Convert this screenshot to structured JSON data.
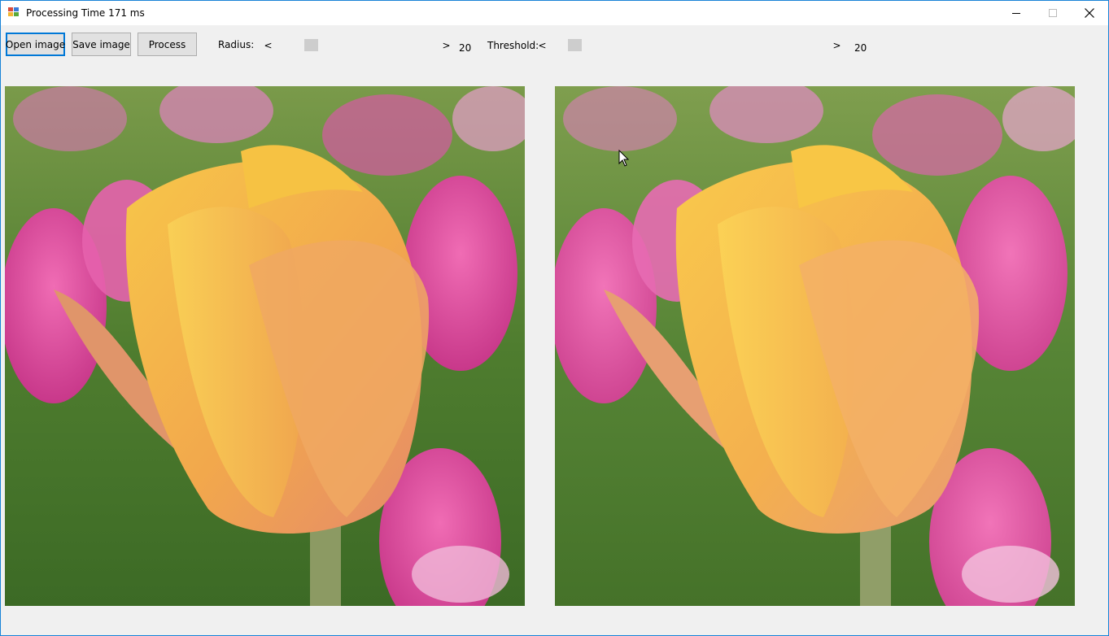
{
  "window": {
    "title": "Processing Time 171 ms",
    "accent_color": "#1883d7",
    "caption_icons": [
      "minimize-icon",
      "maximize-icon",
      "close-icon"
    ]
  },
  "toolbar": {
    "open_label": "Open image",
    "save_label": "Save image",
    "process_label": "Process"
  },
  "radius": {
    "label": "Radius:",
    "value": "20",
    "left_arrow": "<",
    "right_arrow": ">"
  },
  "threshold": {
    "label": "Threshold:",
    "value": "20",
    "left_arrow": "<",
    "right_arrow": ">"
  },
  "images": {
    "original": {
      "subject": "orange tulip with pink tulips in background",
      "style": "sharp"
    },
    "processed": {
      "subject": "orange tulip with pink tulips in background",
      "style": "smoothed"
    }
  },
  "colors": {
    "petal_orange": "#f2a94a",
    "petal_yellow": "#f5c84a",
    "pink": "#d9509a",
    "green": "#5e8a3a"
  }
}
